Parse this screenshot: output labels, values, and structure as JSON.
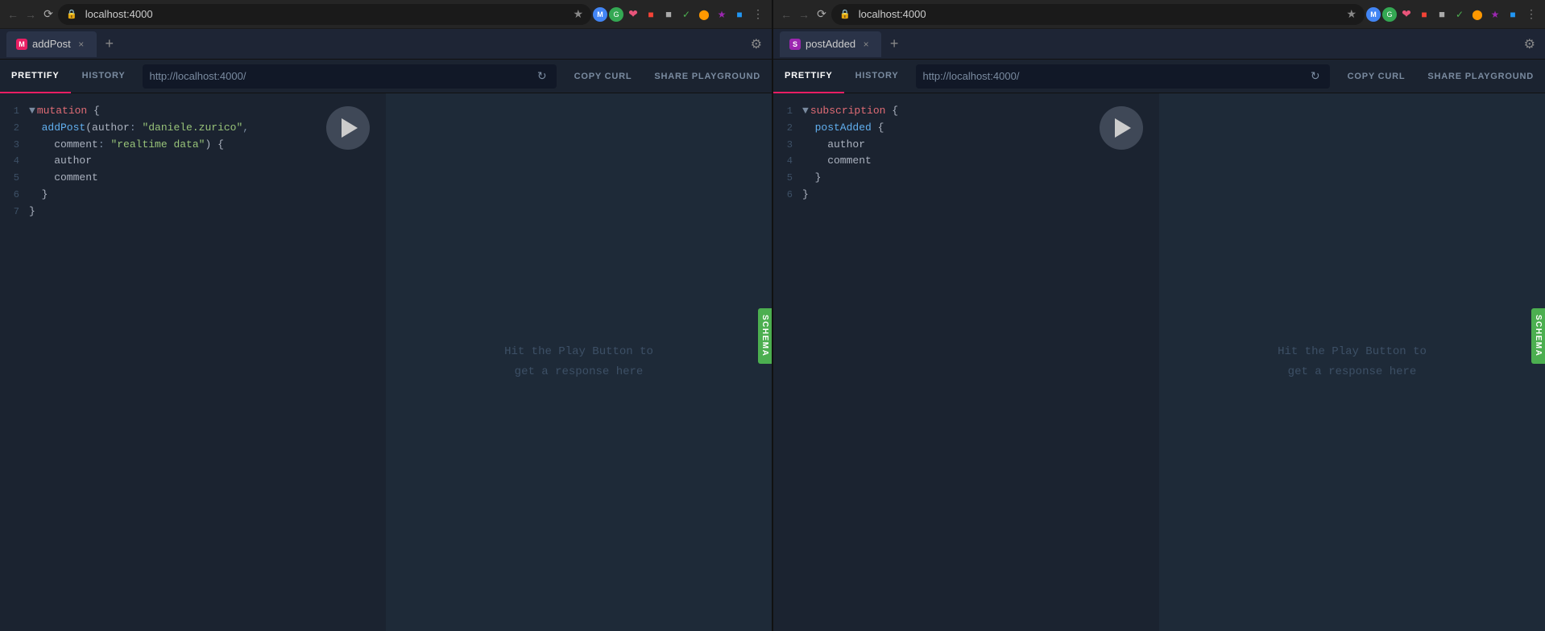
{
  "window1": {
    "url": "localhost:4000",
    "tab": {
      "icon": "M",
      "icon_type": "mutation",
      "label": "addPost",
      "close": "×"
    },
    "tab_add": "+",
    "settings_icon": "⚙",
    "toolbar": {
      "prettify": "PRETTIFY",
      "history": "HISTORY",
      "url": "http://localhost:4000/",
      "copy_curl": "COPY CURL",
      "share_playground": "SHARE PLAYGROUND"
    },
    "schema_tab": "SCHEMA",
    "code_lines": [
      {
        "num": "1",
        "tokens": [
          {
            "type": "collapse",
            "text": "▼"
          },
          {
            "type": "kw",
            "text": "mutation"
          },
          {
            "type": "normal",
            "text": " {"
          }
        ]
      },
      {
        "num": "2",
        "tokens": [
          {
            "type": "fn",
            "text": "  addPost"
          },
          {
            "type": "normal",
            "text": "("
          },
          {
            "type": "normal",
            "text": "author"
          },
          {
            "type": "punct",
            "text": ": "
          },
          {
            "type": "str",
            "text": "\"daniele.zurico\""
          },
          {
            "type": "punct",
            "text": ","
          }
        ]
      },
      {
        "num": "3",
        "tokens": [
          {
            "type": "normal",
            "text": "    comment"
          },
          {
            "type": "punct",
            "text": ": "
          },
          {
            "type": "str",
            "text": "\"realtime data\""
          },
          {
            "type": "normal",
            "text": ") {"
          }
        ]
      },
      {
        "num": "4",
        "tokens": [
          {
            "type": "normal",
            "text": "    author"
          }
        ]
      },
      {
        "num": "5",
        "tokens": [
          {
            "type": "normal",
            "text": "    comment"
          }
        ]
      },
      {
        "num": "6",
        "tokens": [
          {
            "type": "normal",
            "text": "  }"
          }
        ]
      },
      {
        "num": "7",
        "tokens": [
          {
            "type": "normal",
            "text": "}"
          }
        ]
      }
    ],
    "response_placeholder": "Hit the Play Button to\nget a response here"
  },
  "window2": {
    "url": "localhost:4000",
    "tab": {
      "icon": "S",
      "icon_type": "subscription",
      "label": "postAdded",
      "close": "×"
    },
    "tab_add": "+",
    "settings_icon": "⚙",
    "toolbar": {
      "prettify": "PRETTIFY",
      "history": "HISTORY",
      "url": "http://localhost:4000/",
      "copy_curl": "COPY CURL",
      "share_playground": "SHARE PLAYGROUND"
    },
    "schema_tab": "SCHEMA",
    "code_lines": [
      {
        "num": "1",
        "tokens": [
          {
            "type": "collapse",
            "text": "▼"
          },
          {
            "type": "kw",
            "text": "subscription"
          },
          {
            "type": "normal",
            "text": " {"
          }
        ]
      },
      {
        "num": "2",
        "tokens": [
          {
            "type": "fn",
            "text": "  postAdded"
          },
          {
            "type": "normal",
            "text": " {"
          }
        ]
      },
      {
        "num": "3",
        "tokens": [
          {
            "type": "normal",
            "text": "    author"
          }
        ]
      },
      {
        "num": "4",
        "tokens": [
          {
            "type": "normal",
            "text": "    comment"
          }
        ]
      },
      {
        "num": "5",
        "tokens": [
          {
            "type": "normal",
            "text": "  }"
          }
        ]
      },
      {
        "num": "6",
        "tokens": [
          {
            "type": "normal",
            "text": "}"
          }
        ]
      }
    ],
    "response_placeholder": "Hit the Play Button to\nget a response here"
  }
}
